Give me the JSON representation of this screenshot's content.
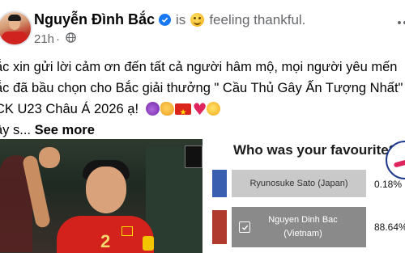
{
  "post": {
    "author_name": "Nguyễn Đình Bắc",
    "status_is": "is",
    "feeling": "feeling thankful.",
    "time": "21h",
    "caption_lines": [
      "ắc xin gửi lời cảm ơn đến tất cả người hâm mộ, mọi người yêu mến",
      "ắc đã bầu chọn cho Bắc giải thưởng \" Cầu Thủ Gây Ấn Tượng Nhất\"",
      "CK U23 Châu Á 2026 ạ!"
    ],
    "caption_last": "ây s...",
    "see_more": "See more"
  },
  "media": {
    "jersey_number": "2",
    "poll": {
      "question": "Who was your favourite?",
      "options": [
        {
          "label": "Ryunosuke Sato (Japan)",
          "percent": "0.18%",
          "selected": false
        },
        {
          "label_lines": [
            "Nguyen Dinh Bac",
            "(Vietnam)"
          ],
          "percent": "88.64%",
          "selected": true
        }
      ]
    }
  },
  "icons": {
    "verified": "verified-badge-icon",
    "globe": "globe-icon",
    "more": "more-options-icon",
    "feeling": "smiling-face-icon"
  },
  "colors": {
    "verified_blue": "#1877f2",
    "meta_gray": "#65676b",
    "poll_bar": "#c9c9c9",
    "poll_bar_selected": "#8a8a8a"
  }
}
